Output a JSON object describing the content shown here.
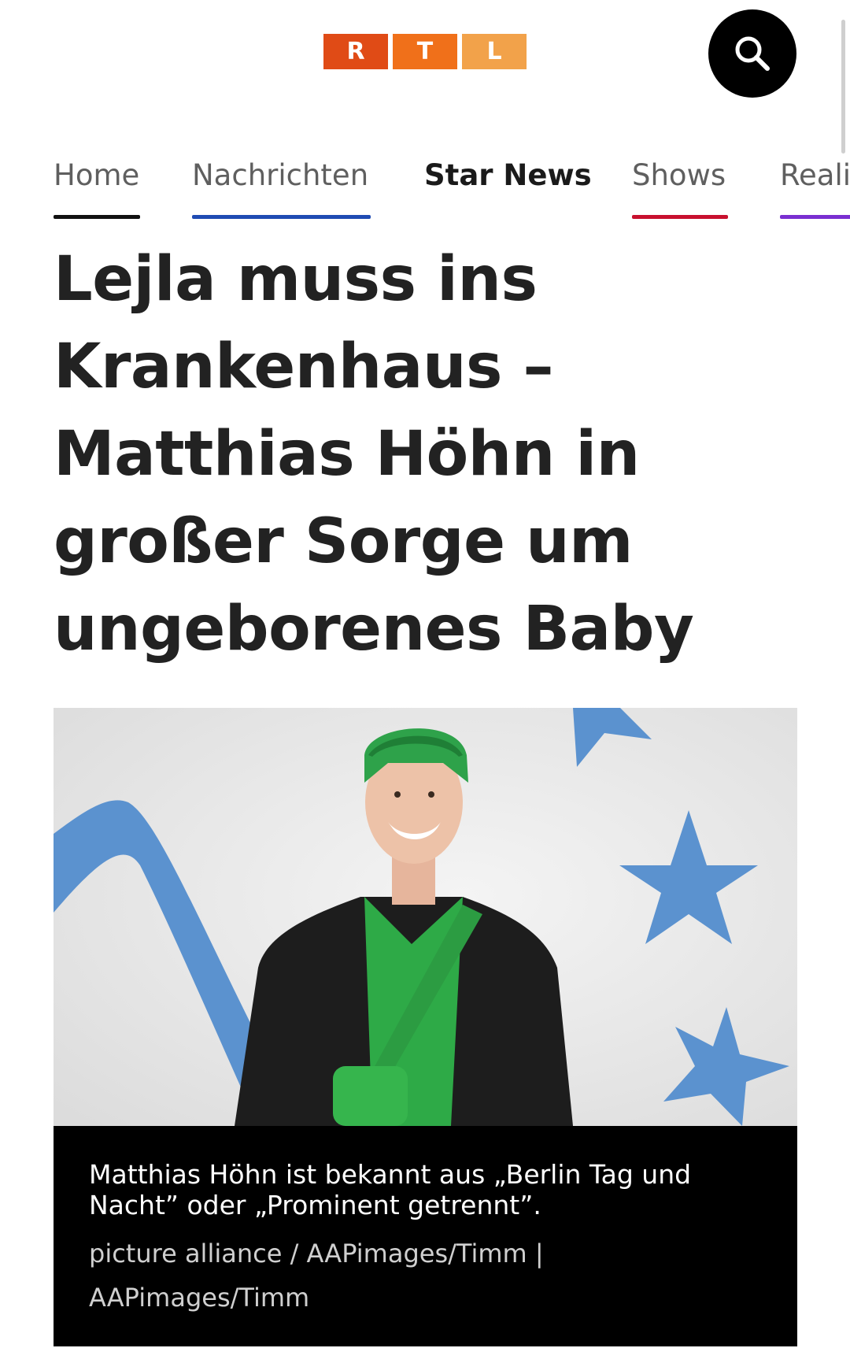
{
  "brand": {
    "logo_letters": [
      "R",
      "T",
      "L"
    ],
    "logo_colors": [
      "#e04b16",
      "#f0701a",
      "#f2a24a"
    ]
  },
  "header": {
    "search_icon": "search-icon"
  },
  "nav": {
    "items": [
      {
        "label": "Home",
        "accent": "#111111",
        "active": false
      },
      {
        "label": "Nachrichten",
        "accent": "#1f4bb3",
        "active": false
      },
      {
        "label": "Star News",
        "accent": "",
        "active": true
      },
      {
        "label": "Shows",
        "accent": "#c8102e",
        "active": false
      },
      {
        "label": "Reali",
        "accent": "#7a2fd1",
        "active": false
      }
    ]
  },
  "article": {
    "headline": "Lejla muss ins Krankenhaus – Matthias Höhn in großer Sorge um ungeborenes Baby",
    "image": {
      "caption": "Matthias Höhn ist bekannt aus „Berlin Tag und Nacht” oder „Prominent getrennt”.",
      "credit": "picture alliance / AAPimages/Timm | AAPimages/Timm"
    }
  }
}
